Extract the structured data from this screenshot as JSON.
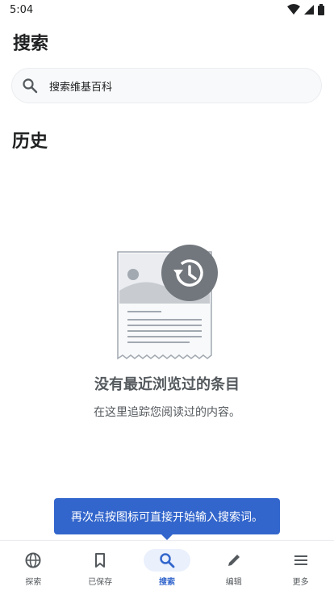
{
  "status_bar": {
    "time": "5:04"
  },
  "header": {
    "title": "搜索"
  },
  "search": {
    "placeholder": "搜索维基百科"
  },
  "history": {
    "title": "历史",
    "empty_title": "没有最近浏览过的条目",
    "empty_subtitle": "在这里追踪您阅读过的内容。"
  },
  "tooltip": {
    "text": "再次点按图标可直接开始输入搜索词。"
  },
  "bottom_nav": {
    "items": [
      {
        "label": "探索",
        "icon": "globe-icon"
      },
      {
        "label": "已保存",
        "icon": "bookmark-icon"
      },
      {
        "label": "搜索",
        "icon": "search-icon",
        "active": true
      },
      {
        "label": "编辑",
        "icon": "pencil-icon"
      },
      {
        "label": "更多",
        "icon": "menu-icon"
      }
    ]
  },
  "colors": {
    "accent": "#3366cc",
    "text": "#202122",
    "muted": "#54595d"
  }
}
